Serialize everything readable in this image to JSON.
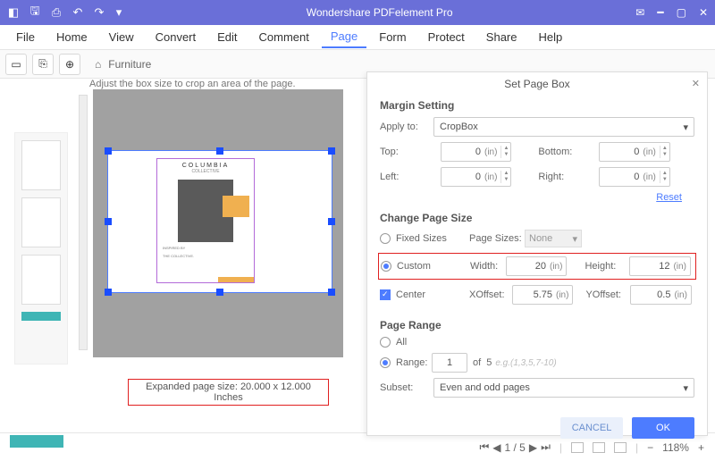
{
  "title": "Wondershare PDFelement Pro",
  "menus": [
    "File",
    "Home",
    "View",
    "Convert",
    "Edit",
    "Comment",
    "Page",
    "Form",
    "Protect",
    "Share",
    "Help"
  ],
  "active_menu": "Page",
  "breadcrumb": {
    "home_icon": "⌂",
    "item": "Furniture"
  },
  "preview": {
    "hint": "Adjust the box size to crop an area of the page.",
    "doc_title": "COLUMBIA",
    "doc_sub": "COLLECTIVE",
    "expanded": "Expanded page size: 20.000 x 12.000 Inches",
    "caption1": "INSPIRED BY",
    "caption2": "THE COLLECTIVE."
  },
  "dialog": {
    "title": "Set Page Box",
    "margin": {
      "heading": "Margin Setting",
      "apply_to_lbl": "Apply to:",
      "apply_to_val": "CropBox",
      "top_lbl": "Top:",
      "top_val": "0",
      "top_unit": "(in)",
      "bottom_lbl": "Bottom:",
      "bottom_val": "0",
      "bottom_unit": "(in)",
      "left_lbl": "Left:",
      "left_val": "0",
      "left_unit": "(in)",
      "right_lbl": "Right:",
      "right_val": "0",
      "right_unit": "(in)",
      "reset": "Reset"
    },
    "size": {
      "heading": "Change Page Size",
      "fixed_lbl": "Fixed Sizes",
      "page_sizes_lbl": "Page Sizes:",
      "page_sizes_val": "None",
      "custom_lbl": "Custom",
      "width_lbl": "Width:",
      "width_val": "20",
      "width_unit": "(in)",
      "height_lbl": "Height:",
      "height_val": "12",
      "height_unit": "(in)",
      "center_lbl": "Center",
      "xoff_lbl": "XOffset:",
      "xoff_val": "5.75",
      "xoff_unit": "(in)",
      "yoff_lbl": "YOffset:",
      "yoff_val": "0.5",
      "yoff_unit": "(in)"
    },
    "range": {
      "heading": "Page Range",
      "all_lbl": "All",
      "range_lbl": "Range:",
      "from": "1",
      "of_lbl": "of",
      "total": "5",
      "eg": "e.g.(1,3,5,7-10)",
      "subset_lbl": "Subset:",
      "subset_val": "Even and odd pages"
    },
    "cancel": "CANCEL",
    "ok": "OK"
  },
  "status": {
    "page": "1 / 5",
    "zoom": "118%"
  }
}
